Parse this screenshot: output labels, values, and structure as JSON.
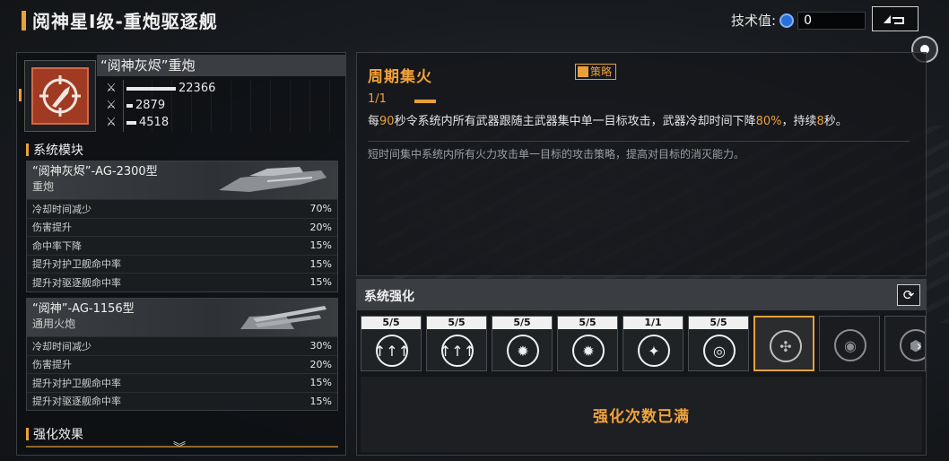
{
  "header": {
    "title": "阅神星I级-重炮驱逐舰",
    "tech_label": "技术值:",
    "tech_value": "0",
    "back_icon": "back-arrow-icon"
  },
  "weapon": {
    "name": "“阅神灰烬”重炮",
    "icon": "crosshair-shell-icon",
    "stats": [
      {
        "icon": "attack-icon",
        "value": "22366",
        "bar_fraction": 1.0
      },
      {
        "icon": "attack-icon",
        "value": "2879",
        "bar_fraction": 0.13
      },
      {
        "icon": "attack-icon",
        "value": "4518",
        "bar_fraction": 0.2
      }
    ]
  },
  "modules_section": {
    "title": "系统模块",
    "modules": [
      {
        "name": "“阅神灰烬”-AG-2300型",
        "type": "重炮",
        "rows": [
          {
            "label": "冷却时间减少",
            "value": "70%"
          },
          {
            "label": "伤害提升",
            "value": "20%"
          },
          {
            "label": "命中率下降",
            "value": "15%"
          },
          {
            "label": "提升对护卫舰命中率",
            "value": "15%"
          },
          {
            "label": "提升对驱逐舰命中率",
            "value": "15%"
          }
        ]
      },
      {
        "name": "“阅神”-AG-1156型",
        "type": "通用火炮",
        "rows": [
          {
            "label": "冷却时间减少",
            "value": "30%"
          },
          {
            "label": "伤害提升",
            "value": "20%"
          },
          {
            "label": "提升对护卫舰命中率",
            "value": "15%"
          },
          {
            "label": "提升对驱逐舰命中率",
            "value": "15%"
          }
        ]
      }
    ]
  },
  "effects_section": {
    "title": "强化效果"
  },
  "skill": {
    "name": "周期集火",
    "tag": "策略",
    "level": "1/1",
    "desc_parts": [
      "每",
      "90",
      "秒令系统内所有武器跟随主武器集中单一目标攻击，武器冷却时间下降",
      "80%",
      "，持续",
      "8",
      "秒。"
    ],
    "flavor": "短时间集中系统内所有火力攻击单一目标的攻击策略，提高对目标的消灭能力。"
  },
  "enhance": {
    "title": "系统强化",
    "refresh_icon": "refresh-icon",
    "cards": [
      {
        "level": "5/5",
        "icon": "triple-arrow-icon",
        "glyph": "↑↑↑",
        "state": "done"
      },
      {
        "level": "5/5",
        "icon": "triple-arrow-icon",
        "glyph": "↑↑↑",
        "state": "done"
      },
      {
        "level": "5/5",
        "icon": "cannon-icon",
        "glyph": "✹",
        "state": "done"
      },
      {
        "level": "5/5",
        "icon": "cannon-icon",
        "glyph": "✹",
        "state": "done"
      },
      {
        "level": "1/1",
        "icon": "cannon-up-icon",
        "glyph": "✦",
        "state": "done"
      },
      {
        "level": "5/5",
        "icon": "radar-icon",
        "glyph": "◎",
        "state": "done"
      },
      {
        "level": "",
        "icon": "focus-fire-icon",
        "glyph": "✣",
        "state": "selected"
      },
      {
        "level": "",
        "icon": "radar-icon",
        "glyph": "◉",
        "state": "locked"
      },
      {
        "level": "",
        "icon": "hex-icon",
        "glyph": "⬢",
        "state": "partial"
      }
    ],
    "status": "强化次数已满"
  },
  "colors": {
    "accent": "#e8a13a",
    "highlight": "#f0a23a"
  }
}
